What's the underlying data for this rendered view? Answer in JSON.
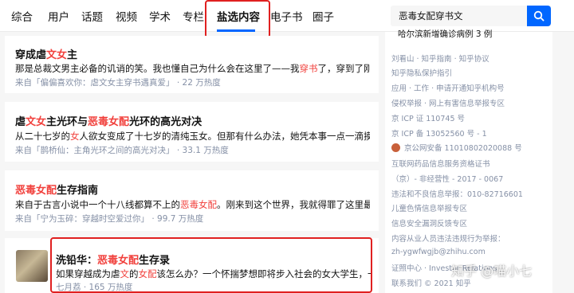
{
  "nav": {
    "tabs": [
      "综合",
      "用户",
      "话题",
      "视频",
      "学术",
      "专栏",
      "盐选内容",
      "电子书",
      "圈子"
    ],
    "active_tab": "盐选内容"
  },
  "search": {
    "query": "恶毒女配穿书文"
  },
  "colors": {
    "accent": "#0066ff",
    "highlight": "#f1403c",
    "annotation": "#e02020"
  },
  "results": [
    {
      "title_parts": [
        [
          "穿成虐",
          false
        ],
        [
          "文女",
          true
        ],
        [
          "主",
          false
        ]
      ],
      "line_parts": [
        [
          "那是总裁文男主必备的讥诮的笑。我也懂自己为什么会在这里了——我",
          false
        ],
        [
          "穿书",
          true
        ],
        [
          "了，穿到了刚看完的究极...",
          false
        ]
      ],
      "meta": "来自「偏偏喜欢你：虐文女主穿书遇真爱」 · 22 万热度"
    },
    {
      "title_parts": [
        [
          "虐",
          false
        ],
        [
          "文女",
          true
        ],
        [
          "主光环与",
          false
        ],
        [
          "恶毒女配",
          true
        ],
        [
          "光环的高光对决",
          false
        ]
      ],
      "line_parts": [
        [
          "从二十七岁的",
          false
        ],
        [
          "女",
          true
        ],
        [
          "人欲女变成了十七岁的清纯玉女。但那有什么办法，她凭本事一点一滴摸索了四年多...",
          false
        ]
      ],
      "meta": "来自「鹊桥仙：主角光环之间的高光对决」 · 33.1 万热度"
    },
    {
      "title_parts": [
        [
          "恶毒女配",
          true
        ],
        [
          "生存指南",
          false
        ]
      ],
      "line_parts": [
        [
          "来自于古言小说中一个十八线都算不上的",
          false
        ],
        [
          "恶毒女配",
          true
        ],
        [
          "。刚来到这个世界，我就得罪了这里最不能得罪的...",
          false
        ]
      ],
      "meta": "来自「宁为玉碎：穿越时空爱过你」 · 99.7 万热度"
    },
    {
      "title_parts": [
        [
          "洗铅华：",
          false
        ],
        [
          "恶毒女配",
          true
        ],
        [
          "生存录",
          false
        ]
      ],
      "line_parts": [
        [
          "如果穿越成为虐",
          false
        ],
        [
          "文",
          true
        ],
        [
          "的",
          false
        ],
        [
          "女配",
          true
        ],
        [
          "该怎么办？一个怀揣梦想即将步入社会的女大学生，一觉醒来发...",
          false
        ]
      ],
      "meta": "七月荔 · 165 万热度"
    }
  ],
  "sidebar": {
    "top_text": "哈尔滨新增确诊病例 3 例",
    "lines": [
      "刘看山 · 知乎指南 · 知乎协议",
      "知乎隐私保护指引",
      "应用 · 工作 · 申请开通知乎机构号",
      "侵权举报 · 网上有害信息举报专区",
      "京 ICP 证 110745 号",
      "京 ICP 备 13052560 号 - 1",
      "京公网安备 11010802020088 号",
      "互联网药品信息服务资格证书",
      "（京）- 非经营性 - 2017 - 0067",
      "违法和不良信息举报：010-82716601",
      "儿童色情信息举报专区",
      "信息安全漏洞反馈专区",
      "内容从业人员违法违规行为举报：",
      "zh-ygwfwgjb@zhihu.com",
      "证照中心 · Investor Relations",
      "联系我们 © 2021 知乎"
    ]
  },
  "watermark": "知乎 @喵小七"
}
